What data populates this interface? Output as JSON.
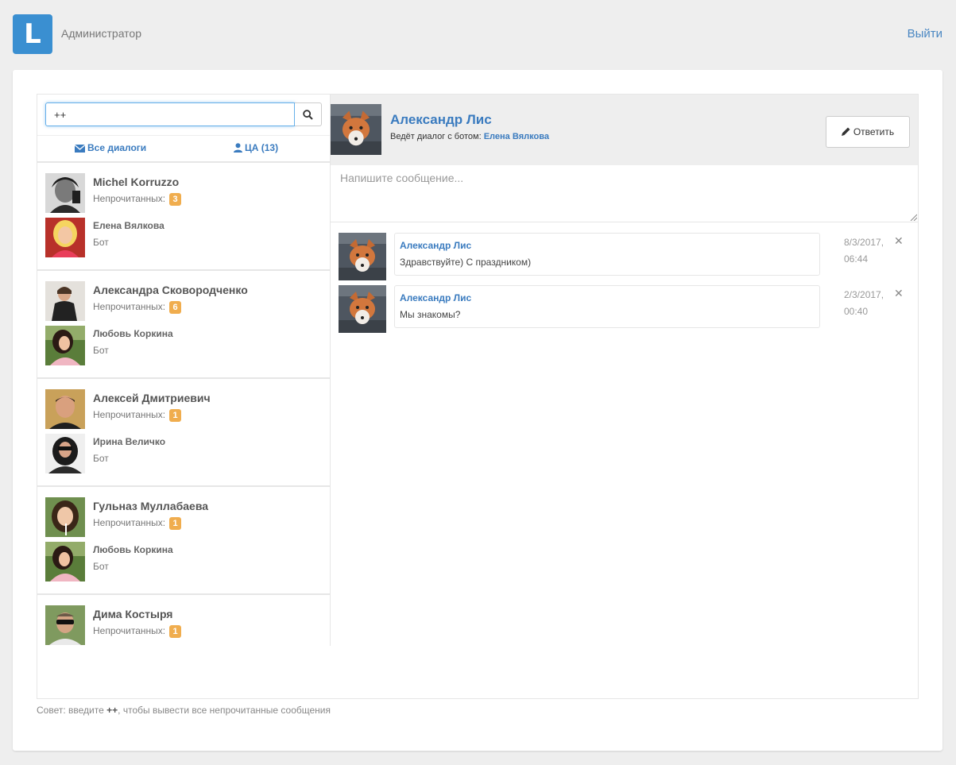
{
  "header": {
    "logo_letter": "L",
    "user": "Администратор",
    "logout": "Выйти",
    "accent": "#3a8fd1"
  },
  "search": {
    "value": "++",
    "button_icon": "search-icon"
  },
  "filters": {
    "all": "Все диалоги",
    "ca": "ЦА (13)"
  },
  "dialogs": [
    {
      "user": "Michel Korruzzo",
      "unread_label": "Непрочитанных:",
      "unread": "3",
      "bot": "Елена Вялкова",
      "role": "Бот"
    },
    {
      "user": "Александра Сковородченко",
      "unread_label": "Непрочитанных:",
      "unread": "6",
      "bot": "Любовь Коркина",
      "role": "Бот"
    },
    {
      "user": "Алексей Дмитриевич",
      "unread_label": "Непрочитанных:",
      "unread": "1",
      "bot": "Ирина Величко",
      "role": "Бот"
    },
    {
      "user": "Гульназ Муллабаева",
      "unread_label": "Непрочитанных:",
      "unread": "1",
      "bot": "Любовь Коркина",
      "role": "Бот"
    },
    {
      "user": "Дима Костыря",
      "unread_label": "Непрочитанных:",
      "unread": "1"
    }
  ],
  "chat": {
    "name": "Александр Лис",
    "sub_label": "Ведёт диалог с ботом:",
    "bot": "Елена Вялкова",
    "reply_button": "Ответить",
    "input_placeholder": "Напишите сообщение...",
    "messages": [
      {
        "author": "Александр Лис",
        "text": "Здравствуйте) С праздником)",
        "date": "8/3/2017,",
        "time": "06:44"
      },
      {
        "author": "Александр Лис",
        "text": "Мы знакомы?",
        "date": "2/3/2017,",
        "time": "00:40"
      }
    ]
  },
  "hint": {
    "prefix": "Совет: введите",
    "code": "++",
    "suffix": ", чтобы вывести все непрочитанные сообщения"
  }
}
